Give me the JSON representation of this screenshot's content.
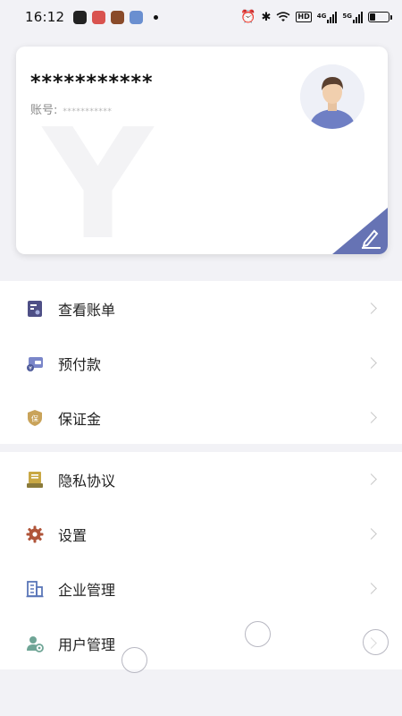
{
  "status_bar": {
    "time": "16:12",
    "hd_label": "HD",
    "net1_label": "4G",
    "net2_label": "5G",
    "battery_level": 0.3
  },
  "profile": {
    "name": "***********",
    "account_label": "账号:",
    "account_value": "***********",
    "watermark": "Y"
  },
  "menu": {
    "group1": [
      {
        "label": "查看账单",
        "icon": "bill-icon",
        "color": "#4e4f86"
      },
      {
        "label": "预付款",
        "icon": "prepaid-icon",
        "color": "#7a86c9"
      },
      {
        "label": "保证金",
        "icon": "deposit-shield-icon",
        "color": "#c9a35a",
        "icon_text": "保"
      }
    ],
    "group2": [
      {
        "label": "隐私协议",
        "icon": "privacy-icon",
        "color": "#c9a844"
      },
      {
        "label": "设置",
        "icon": "settings-gear-icon",
        "color": "#b0553a"
      },
      {
        "label": "企业管理",
        "icon": "enterprise-building-icon",
        "color": "#5a76b8"
      },
      {
        "label": "用户管理",
        "icon": "user-manage-icon",
        "color": "#6fa596"
      }
    ]
  },
  "colors": {
    "accent": "#6673b4",
    "background": "#f2f2f6"
  }
}
